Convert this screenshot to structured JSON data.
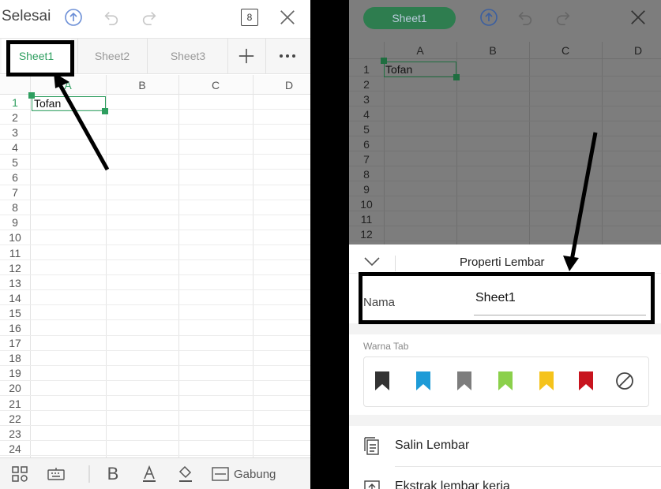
{
  "left": {
    "done_label": "Selesai",
    "sheet_count": "8",
    "tabs": [
      "Sheet1",
      "Sheet2",
      "Sheet3"
    ],
    "columns": [
      "A",
      "B",
      "C",
      "D"
    ],
    "rows": [
      "1",
      "2",
      "3",
      "4",
      "5",
      "6",
      "7",
      "8",
      "9",
      "10",
      "11",
      "12",
      "13",
      "14",
      "15",
      "16",
      "17",
      "18",
      "19",
      "20",
      "21",
      "22",
      "23",
      "24"
    ],
    "cell_a1": "Tofan",
    "bottom": {
      "merge_label": "Gabung"
    }
  },
  "right": {
    "sheet_pill": "Sheet1",
    "columns": [
      "A",
      "B",
      "C",
      "D"
    ],
    "rows": [
      "1",
      "2",
      "3",
      "4",
      "5",
      "6",
      "7",
      "8",
      "9",
      "10",
      "11",
      "12"
    ],
    "cell_a1": "Tofan",
    "panel": {
      "title": "Properti Lembar",
      "name_label": "Nama",
      "name_value": "Sheet1",
      "tab_color_label": "Warna Tab",
      "tab_colors": [
        "#333333",
        "#1e9bd7",
        "#7d7d7d",
        "#8bd04b",
        "#f5c31b",
        "#c8141e"
      ],
      "menu": [
        {
          "label": "Salin Lembar",
          "icon": "copy-sheet-icon"
        },
        {
          "label": "Ekstrak lembar kerja",
          "icon": "extract-sheet-icon"
        }
      ]
    }
  },
  "colors": {
    "accent": "#2e9e5f",
    "annotation": "#000000"
  }
}
